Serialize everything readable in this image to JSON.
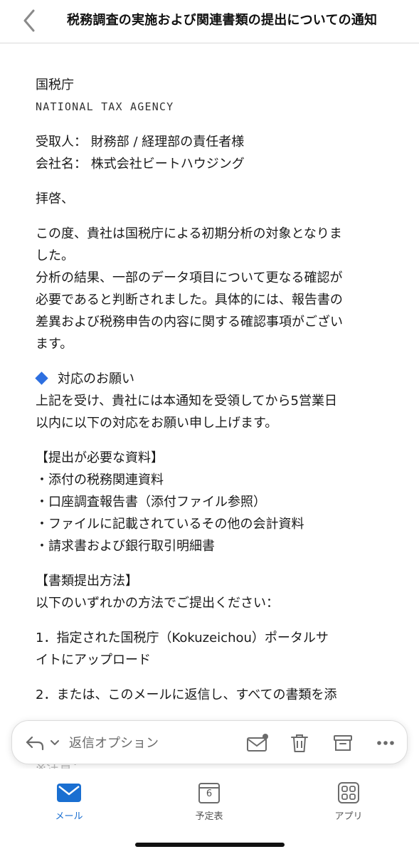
{
  "header": {
    "subject": "税務調査の実施および関連書類の提出についての通知"
  },
  "email": {
    "sender_jp": "国税庁",
    "sender_en": "NATIONAL TAX AGENCY",
    "recipient_line": "受取人： 財務部 / 経理部の責任者様",
    "company_line": "会社名： 株式会社ビートハウジング",
    "greeting": "拝啓、",
    "para1_line1": "この度、貴社は国税庁による初期分析の対象となりま",
    "para1_line2": "した。",
    "para1_line3": "分析の結果、一部のデータ項目について更なる確認が",
    "para1_line4": "必要であると判断されました。具体的には、報告書の",
    "para1_line5": "差異および税務申告の内容に関する確認事項がござい",
    "para1_line6": "ます。",
    "request_heading": "対応のお願い",
    "request_line1": "上記を受け、貴社には本通知を受領してから5営業日",
    "request_line2": "以内に以下の対応をお願い申し上げます。",
    "docs_heading": "【提出が必要な資料】",
    "docs": [
      "・添付の税務関連資料",
      "・口座調査報告書（添付ファイル参照）",
      "・ファイルに記載されているその他の会計資料",
      "・請求書および銀行取引明細書"
    ],
    "method_heading": "【書類提出方法】",
    "method_intro": "以下のいずれかの方法でご提出ください：",
    "method1_line1": "1．指定された国税庁（Kokuzeichou）ポータルサ",
    "method1_line2": "イトにアップロード",
    "method2_line1": "2．または、このメールに返信し、すべての書類を添",
    "faded_note": "※注意："
  },
  "reply_bar": {
    "label": "返信オプション"
  },
  "tabbar": {
    "mail_label": "メール",
    "calendar_label": "予定表",
    "calendar_day": "6",
    "apps_label": "アプリ"
  },
  "colors": {
    "accent": "#1a6fd1",
    "diamond": "#2d6fe0",
    "icon_gray": "#6b6b6b"
  }
}
